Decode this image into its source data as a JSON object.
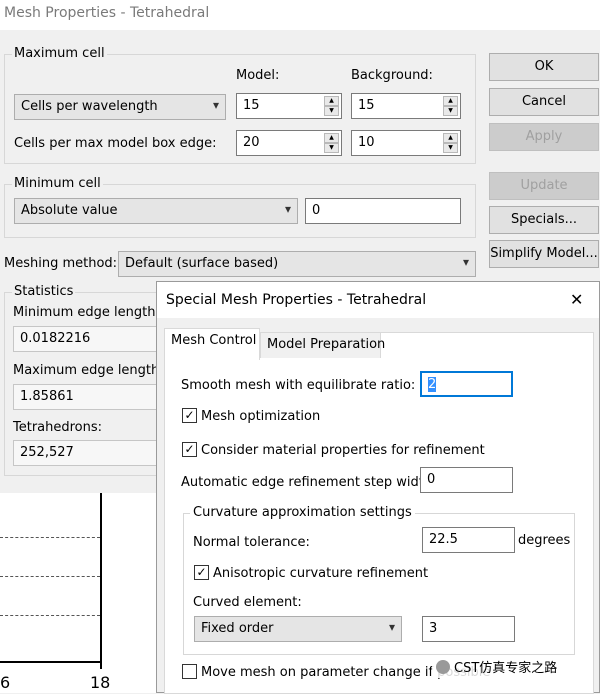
{
  "window": {
    "title": "Mesh Properties - Tetrahedral"
  },
  "max_cell": {
    "legend": "Maximum cell",
    "model_header": "Model:",
    "background_header": "Background:",
    "mode_select": "Cells per wavelength",
    "cells_per_wavelength_model": "15",
    "cells_per_wavelength_background": "15",
    "box_edge_label": "Cells per max model box edge:",
    "box_edge_model": "20",
    "box_edge_background": "10"
  },
  "min_cell": {
    "legend": "Minimum cell",
    "mode_select": "Absolute value",
    "value": "0"
  },
  "meshing": {
    "label": "Meshing method:",
    "value": "Default (surface based)"
  },
  "statistics": {
    "legend": "Statistics",
    "min_edge_label": "Minimum edge length:",
    "min_edge_value": "0.0182216",
    "max_edge_label": "Maximum edge length:",
    "max_edge_value": "1.85861",
    "tetra_label": "Tetrahedrons:",
    "tetra_value": "252,527"
  },
  "buttons": {
    "ok": "OK",
    "cancel": "Cancel",
    "apply": "Apply",
    "update": "Update",
    "specials": "Specials...",
    "simplify": "Simplify Model..."
  },
  "special_dialog": {
    "title": "Special Mesh Properties - Tetrahedral",
    "close_glyph": "✕",
    "tabs": [
      "Mesh Control",
      "Model Preparation"
    ],
    "smooth_label": "Smooth mesh with equilibrate ratio:",
    "smooth_value": "2",
    "mesh_optimization_label": "Mesh optimization",
    "mesh_optimization_checked": true,
    "material_label": "Consider material properties for refinement",
    "material_checked": true,
    "auto_edge_label": "Automatic edge refinement step width",
    "auto_edge_value": "0",
    "curvature": {
      "legend": "Curvature approximation settings",
      "normal_tol_label": "Normal tolerance:",
      "normal_tol_value": "22.5",
      "normal_tol_unit": "degrees",
      "aniso_label": "Anisotropic curvature refinement",
      "aniso_checked": true,
      "curved_element_label": "Curved element:",
      "curved_element_select": "Fixed order",
      "curved_element_order": "3"
    },
    "move_mesh_label": "Move mesh on parameter change if possible",
    "move_mesh_checked": false
  },
  "background_chart": {
    "tick_left": "6",
    "tick_right": "18"
  },
  "watermark": "CST仿真专家之路"
}
